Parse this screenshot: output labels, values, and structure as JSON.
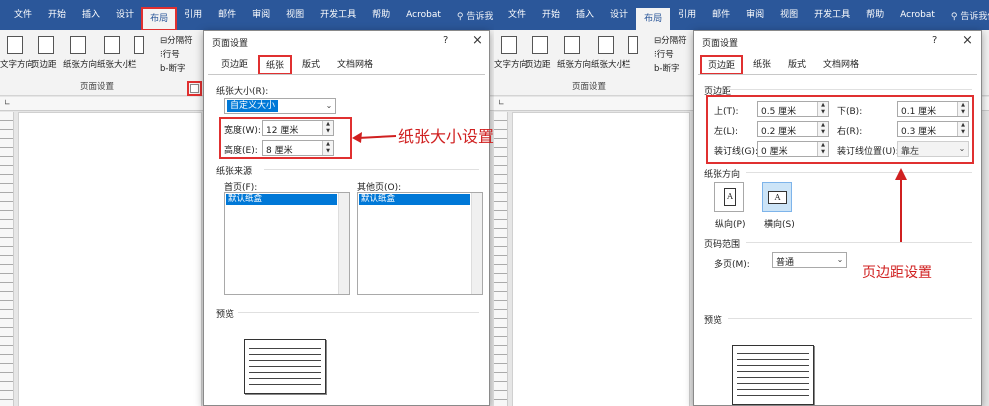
{
  "ribbon": {
    "tabs": [
      "文件",
      "开始",
      "插入",
      "设计",
      "布局",
      "引用",
      "邮件",
      "审阅",
      "视图",
      "开发工具",
      "帮助",
      "Acrobat"
    ],
    "tell_me": "告诉我",
    "tell_me_right": "告诉我你",
    "commands": {
      "text_direction": "文字方向",
      "margins": "页边距",
      "orientation": "纸张方向",
      "size": "纸张大小",
      "columns": "栏",
      "breaks": "分隔符",
      "line_numbers": "行号",
      "hyphenation": "断字"
    },
    "group_label": "页面设置"
  },
  "dialog_left": {
    "title": "页面设置",
    "help": "?",
    "close": "×",
    "tabs": [
      "页边距",
      "纸张",
      "版式",
      "文档网格"
    ],
    "paper_size_label": "纸张大小(R):",
    "paper_size_value": "自定义大小",
    "width_label": "宽度(W):",
    "width_value": "12 厘米",
    "height_label": "高度(E):",
    "height_value": "8 厘米",
    "paper_source_label": "纸张来源",
    "first_page_label": "首页(F):",
    "other_pages_label": "其他页(O):",
    "first_page_item": "默认纸盒",
    "other_pages_item": "默认纸盒",
    "preview_label": "预览"
  },
  "dialog_right": {
    "title": "页面设置",
    "help": "?",
    "close": "×",
    "tabs": [
      "页边距",
      "纸张",
      "版式",
      "文档网格"
    ],
    "margins_label": "页边距",
    "top_label": "上(T):",
    "top_value": "0.5 厘米",
    "bottom_label": "下(B):",
    "bottom_value": "0.1 厘米",
    "left_label": "左(L):",
    "left_value": "0.2 厘米",
    "right_label": "右(R):",
    "right_value": "0.3 厘米",
    "gutter_label": "装订线(G):",
    "gutter_value": "0 厘米",
    "gutter_pos_label": "装订线位置(U):",
    "gutter_pos_value": "靠左",
    "orientation_label": "纸张方向",
    "portrait_label": "纵向(P)",
    "landscape_label": "横向(S)",
    "pages_label": "页码范围",
    "multiple_pages_label": "多页(M):",
    "multiple_pages_value": "普通",
    "preview_label": "预览"
  },
  "annotations": {
    "paper_size": "纸张大小设置",
    "margins": "页边距设置"
  },
  "colors": {
    "ribbon": "#2b579a",
    "highlight": "#e03030",
    "annotation": "#d02020",
    "selection": "#0078d7"
  }
}
